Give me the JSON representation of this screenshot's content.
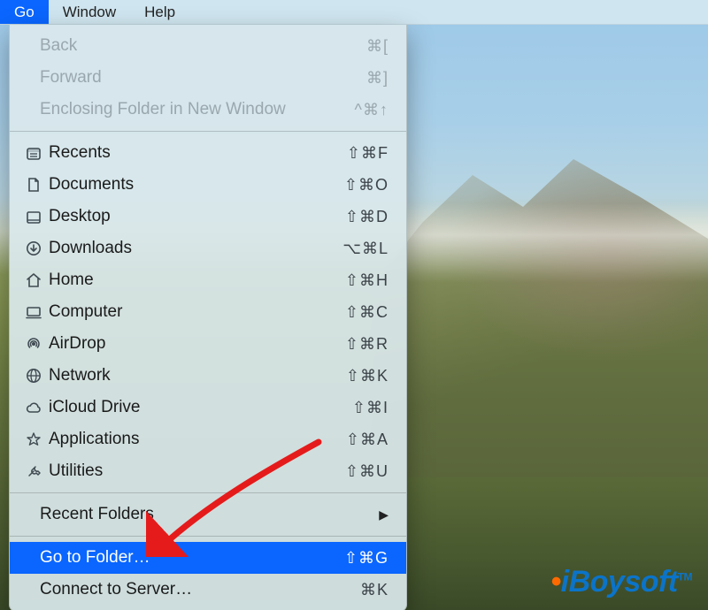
{
  "menubar": {
    "items": [
      {
        "label": "Go",
        "selected": true
      },
      {
        "label": "Window",
        "selected": false
      },
      {
        "label": "Help",
        "selected": false
      }
    ]
  },
  "menu": {
    "nav": [
      {
        "label": "Back",
        "shortcut": "⌘[",
        "disabled": true
      },
      {
        "label": "Forward",
        "shortcut": "⌘]",
        "disabled": true
      },
      {
        "label": "Enclosing Folder in New Window",
        "shortcut": "^⌘↑",
        "disabled": true
      }
    ],
    "places": [
      {
        "icon": "recents-icon",
        "label": "Recents",
        "shortcut": "⇧⌘F"
      },
      {
        "icon": "documents-icon",
        "label": "Documents",
        "shortcut": "⇧⌘O"
      },
      {
        "icon": "desktop-icon",
        "label": "Desktop",
        "shortcut": "⇧⌘D"
      },
      {
        "icon": "downloads-icon",
        "label": "Downloads",
        "shortcut": "⌥⌘L"
      },
      {
        "icon": "home-icon",
        "label": "Home",
        "shortcut": "⇧⌘H"
      },
      {
        "icon": "computer-icon",
        "label": "Computer",
        "shortcut": "⇧⌘C"
      },
      {
        "icon": "airdrop-icon",
        "label": "AirDrop",
        "shortcut": "⇧⌘R"
      },
      {
        "icon": "network-icon",
        "label": "Network",
        "shortcut": "⇧⌘K"
      },
      {
        "icon": "icloud-icon",
        "label": "iCloud Drive",
        "shortcut": "⇧⌘I"
      },
      {
        "icon": "applications-icon",
        "label": "Applications",
        "shortcut": "⇧⌘A"
      },
      {
        "icon": "utilities-icon",
        "label": "Utilities",
        "shortcut": "⇧⌘U"
      }
    ],
    "recent_folders": {
      "label": "Recent Folders",
      "submenu": true
    },
    "actions": [
      {
        "label": "Go to Folder…",
        "shortcut": "⇧⌘G",
        "highlight": true
      },
      {
        "label": "Connect to Server…",
        "shortcut": "⌘K",
        "highlight": false
      }
    ]
  },
  "watermark": {
    "dot": "•",
    "part1": "iBoy",
    "part2": "soft",
    "tm": "TM"
  }
}
